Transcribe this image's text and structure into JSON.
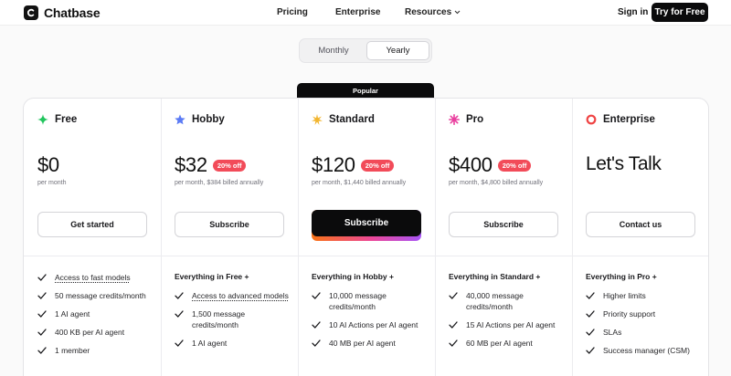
{
  "header": {
    "logo_text": "Chatbase",
    "nav": [
      "Pricing",
      "Enterprise",
      "Resources"
    ],
    "signin": "Sign in",
    "try_button": "Try for Free"
  },
  "billing_toggle": {
    "options": [
      "Monthly",
      "Yearly"
    ],
    "selected": "Yearly"
  },
  "popular_badge": "Popular",
  "colors": {
    "free_icon": "#22c55e",
    "hobby_icon": "#5b7bf5",
    "standard_icon": "#f2b52e",
    "pro_icon": "#e93f9e",
    "enterprise_icon": "#ef4444",
    "discount_badge": "#f24b59"
  },
  "plans": [
    {
      "name": "Free",
      "icon": "sparkle-icon",
      "price": "$0",
      "billing": "per month",
      "cta": "Get started",
      "everything": "",
      "features": [
        "Access to fast models",
        "50 message credits/month",
        "1 AI agent",
        "400 KB per AI agent",
        "1 member"
      ]
    },
    {
      "name": "Hobby",
      "icon": "star-icon",
      "price": "$32",
      "discount": "20% off",
      "billing": "per month, $384 billed annually",
      "cta": "Subscribe",
      "everything": "Everything in Free +",
      "features": [
        "Access to advanced models",
        "1,500 message credits/month",
        "1 AI agent"
      ]
    },
    {
      "name": "Standard",
      "icon": "burst-icon",
      "price": "$120",
      "discount": "20% off",
      "billing": "per month, $1,440 billed annually",
      "cta": "Subscribe",
      "everything": "Everything in Hobby +",
      "features": [
        "10,000 message credits/month",
        "10 AI Actions per AI agent",
        "40 MB per AI agent"
      ]
    },
    {
      "name": "Pro",
      "icon": "starburst-icon",
      "price": "$400",
      "discount": "20% off",
      "billing": "per month, $4,800 billed annually",
      "cta": "Subscribe",
      "everything": "Everything in Standard +",
      "features": [
        "40,000 message credits/month",
        "15 AI Actions per AI agent",
        "60 MB per AI agent"
      ]
    },
    {
      "name": "Enterprise",
      "icon": "ring-icon",
      "price": "Let's Talk",
      "billing": "",
      "cta": "Contact us",
      "everything": "Everything in Pro +",
      "features": [
        "Higher limits",
        "Priority support",
        "SLAs",
        "Success manager (CSM)"
      ]
    }
  ]
}
